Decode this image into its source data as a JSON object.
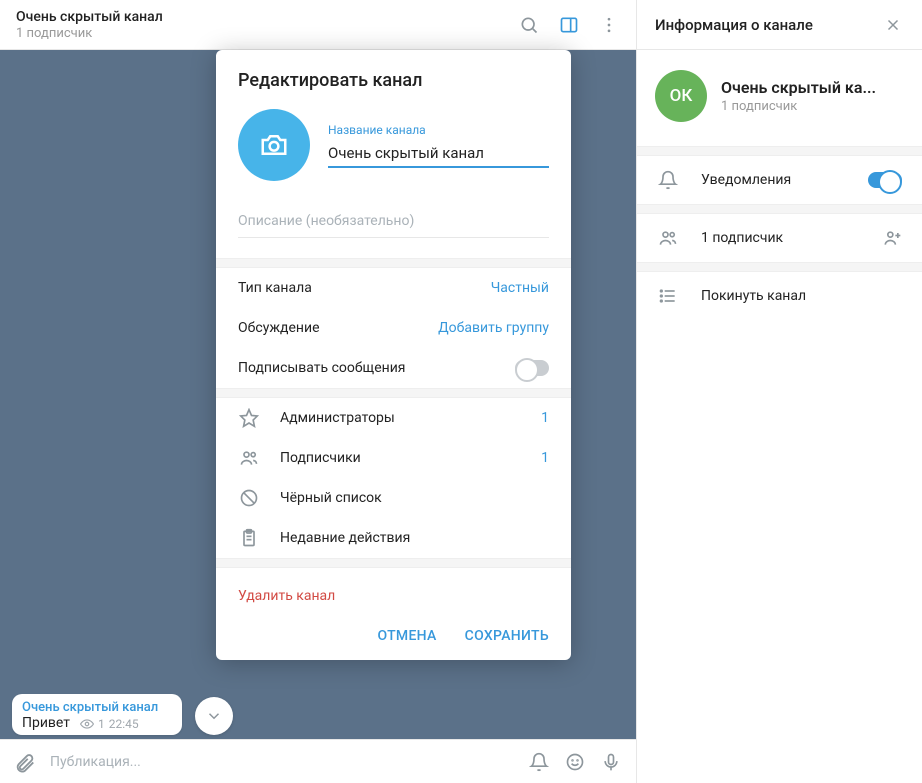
{
  "header": {
    "title": "Очень скрытый канал",
    "subtitle": "1 подписчик"
  },
  "message": {
    "channel": "Очень скрытый канал",
    "text": "Привет",
    "views": "1",
    "time": "22:45"
  },
  "composer": {
    "placeholder": "Публикация..."
  },
  "sidebar": {
    "title": "Информация о канале",
    "avatar_initials": "ОК",
    "name": "Очень скрытый ка...",
    "sub": "1 подписчик",
    "notifications_label": "Уведомления",
    "subscribers_label": "1 подписчик",
    "leave_label": "Покинуть канал"
  },
  "modal": {
    "title": "Редактировать канал",
    "name_label": "Название канала",
    "name_value": "Очень скрытый канал",
    "desc_placeholder": "Описание (необязательно)",
    "type_label": "Тип канала",
    "type_value": "Частный",
    "discussion_label": "Обсуждение",
    "discussion_action": "Добавить группу",
    "sign_label": "Подписывать сообщения",
    "mgmt": [
      {
        "label": "Администраторы",
        "count": "1"
      },
      {
        "label": "Подписчики",
        "count": "1"
      },
      {
        "label": "Чёрный список",
        "count": ""
      },
      {
        "label": "Недавние действия",
        "count": ""
      }
    ],
    "delete": "Удалить канал",
    "cancel": "ОТМЕНА",
    "save": "СОХРАНИТЬ"
  }
}
